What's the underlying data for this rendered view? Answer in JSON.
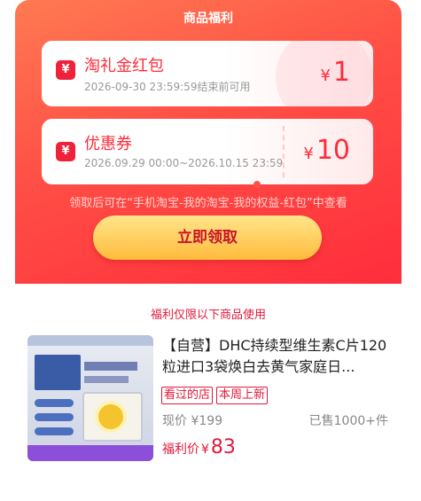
{
  "title": "商品福利",
  "coupons": [
    {
      "icon": "¥",
      "name": "淘礼金红包",
      "desc": "2026-09-30 23:59:59结束前可用",
      "currency": "¥",
      "amount": "1"
    },
    {
      "icon": "¥",
      "name": "优惠券",
      "desc": "2026.09.29 00:00~2026.10.15 23:59",
      "currency": "¥",
      "amount": "10"
    }
  ],
  "hint": "领取后可在“手机淘宝-我的淘宝-我的权益-红包”中查看",
  "claim_button": "立即领取",
  "limit_note": "福利仅限以下商品使用",
  "product": {
    "title": "【自营】DHC持续型维生素C片120粒进口3袋焕白去黄气家庭日...",
    "tags": [
      "看过的店",
      "本周上新"
    ],
    "price_label": "现价",
    "currency": "¥",
    "price": "199",
    "sold": "已售1000+件",
    "welfare_label": "福利价",
    "welfare_price": "83"
  },
  "colors": {
    "accent": "#ff2b3a",
    "button": "#ffcf5a",
    "tag": "#e0193b"
  }
}
